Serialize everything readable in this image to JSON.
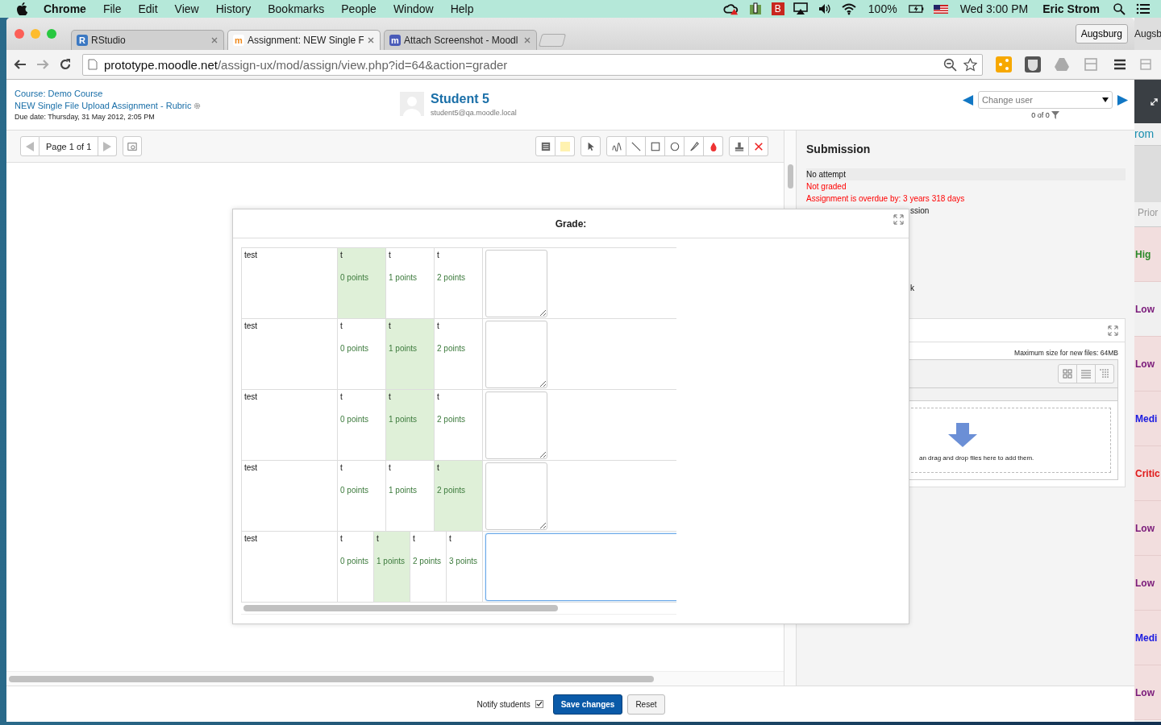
{
  "menubar": {
    "app": "Chrome",
    "menus": [
      "File",
      "Edit",
      "View",
      "History",
      "Bookmarks",
      "People",
      "Window",
      "Help"
    ],
    "badge": "B",
    "battery": "100%",
    "clock": "Wed 3:00 PM",
    "user": "Eric Strom"
  },
  "browser": {
    "tabs": [
      {
        "title": "RStudio",
        "letter": "R",
        "kind": "rstudio",
        "selected": false
      },
      {
        "title": "Assignment: NEW Single F",
        "letter": "m",
        "kind": "moodle",
        "selected": true
      },
      {
        "title": "Attach Screenshot - Moodl",
        "letter": "m",
        "kind": "moodle-blue",
        "selected": false
      }
    ],
    "profile": "Augsburg",
    "url_host": "prototype.moodle.net",
    "url_path": "/assign-ux/mod/assign/view.php?id=64&action=grader"
  },
  "header": {
    "course": "Course: Demo Course",
    "assignment": "NEW Single File Upload Assignment - Rubric",
    "due": "Due date: Thursday, 31 May 2012, 2:05 PM",
    "student": "Student 5",
    "email": "student5@qa.moodle.local",
    "change_user": {
      "placeholder": "Change user"
    },
    "count": "0 of 0"
  },
  "pdf_toolbar": {
    "page_label": "Page 1 of 1"
  },
  "submission": {
    "title": "Submission",
    "lines": [
      {
        "text": "No attempt",
        "kind": "status"
      },
      {
        "text": "Not graded",
        "kind": "alert"
      },
      {
        "text": "Assignment is overdue by: 3 years 318 days",
        "kind": "alert"
      },
      {
        "text": "ssion",
        "kind": "clipped"
      }
    ],
    "fragment": "k",
    "max_size": "Maximum size for new files: 64MB",
    "drop_hint": "an drag and drop files here to add them."
  },
  "grade_dialog": {
    "title": "Grade:",
    "criteria": [
      {
        "description": "test",
        "focused": false,
        "levels": [
          {
            "definition": "t",
            "score": "0 points",
            "selected": true
          },
          {
            "definition": "t",
            "score": "1 points",
            "selected": false
          },
          {
            "definition": "t",
            "score": "2 points",
            "selected": false
          }
        ]
      },
      {
        "description": "test",
        "focused": false,
        "levels": [
          {
            "definition": "t",
            "score": "0 points",
            "selected": false
          },
          {
            "definition": "t",
            "score": "1 points",
            "selected": true
          },
          {
            "definition": "t",
            "score": "2 points",
            "selected": false
          }
        ]
      },
      {
        "description": "test",
        "focused": false,
        "levels": [
          {
            "definition": "t",
            "score": "0 points",
            "selected": false
          },
          {
            "definition": "t",
            "score": "1 points",
            "selected": true
          },
          {
            "definition": "t",
            "score": "2 points",
            "selected": false
          }
        ]
      },
      {
        "description": "test",
        "focused": false,
        "levels": [
          {
            "definition": "t",
            "score": "0 points",
            "selected": false
          },
          {
            "definition": "t",
            "score": "1 points",
            "selected": false
          },
          {
            "definition": "t",
            "score": "2 points",
            "selected": true
          }
        ]
      },
      {
        "description": "test",
        "focused": true,
        "levels": [
          {
            "definition": "t",
            "score": "0 points",
            "selected": false
          },
          {
            "definition": "t",
            "score": "1 points",
            "selected": true
          },
          {
            "definition": "t",
            "score": "2 points",
            "selected": false
          },
          {
            "definition": "t",
            "score": "3 points",
            "selected": false
          }
        ]
      }
    ]
  },
  "footer": {
    "notify_label": "Notify students",
    "notify_checked": true,
    "save": "Save changes",
    "reset": "Reset"
  },
  "background_window": {
    "tab": "Augsb",
    "link": "rom",
    "column": "Prior",
    "rows": [
      {
        "text": "Hig",
        "color": "#2a8a2a"
      },
      {
        "text": "Low",
        "color": "#7a1a7a"
      },
      {
        "text": "Low",
        "color": "#7a1a7a"
      },
      {
        "text": "Medi",
        "color": "#1a1ae0"
      },
      {
        "text": "Critic",
        "color": "#e01a1a"
      },
      {
        "text": "Low",
        "color": "#7a1a7a"
      },
      {
        "text": "Low",
        "color": "#7a1a7a"
      },
      {
        "text": "Medi",
        "color": "#1a1ae0"
      },
      {
        "text": "Low",
        "color": "#7a1a7a"
      }
    ]
  }
}
